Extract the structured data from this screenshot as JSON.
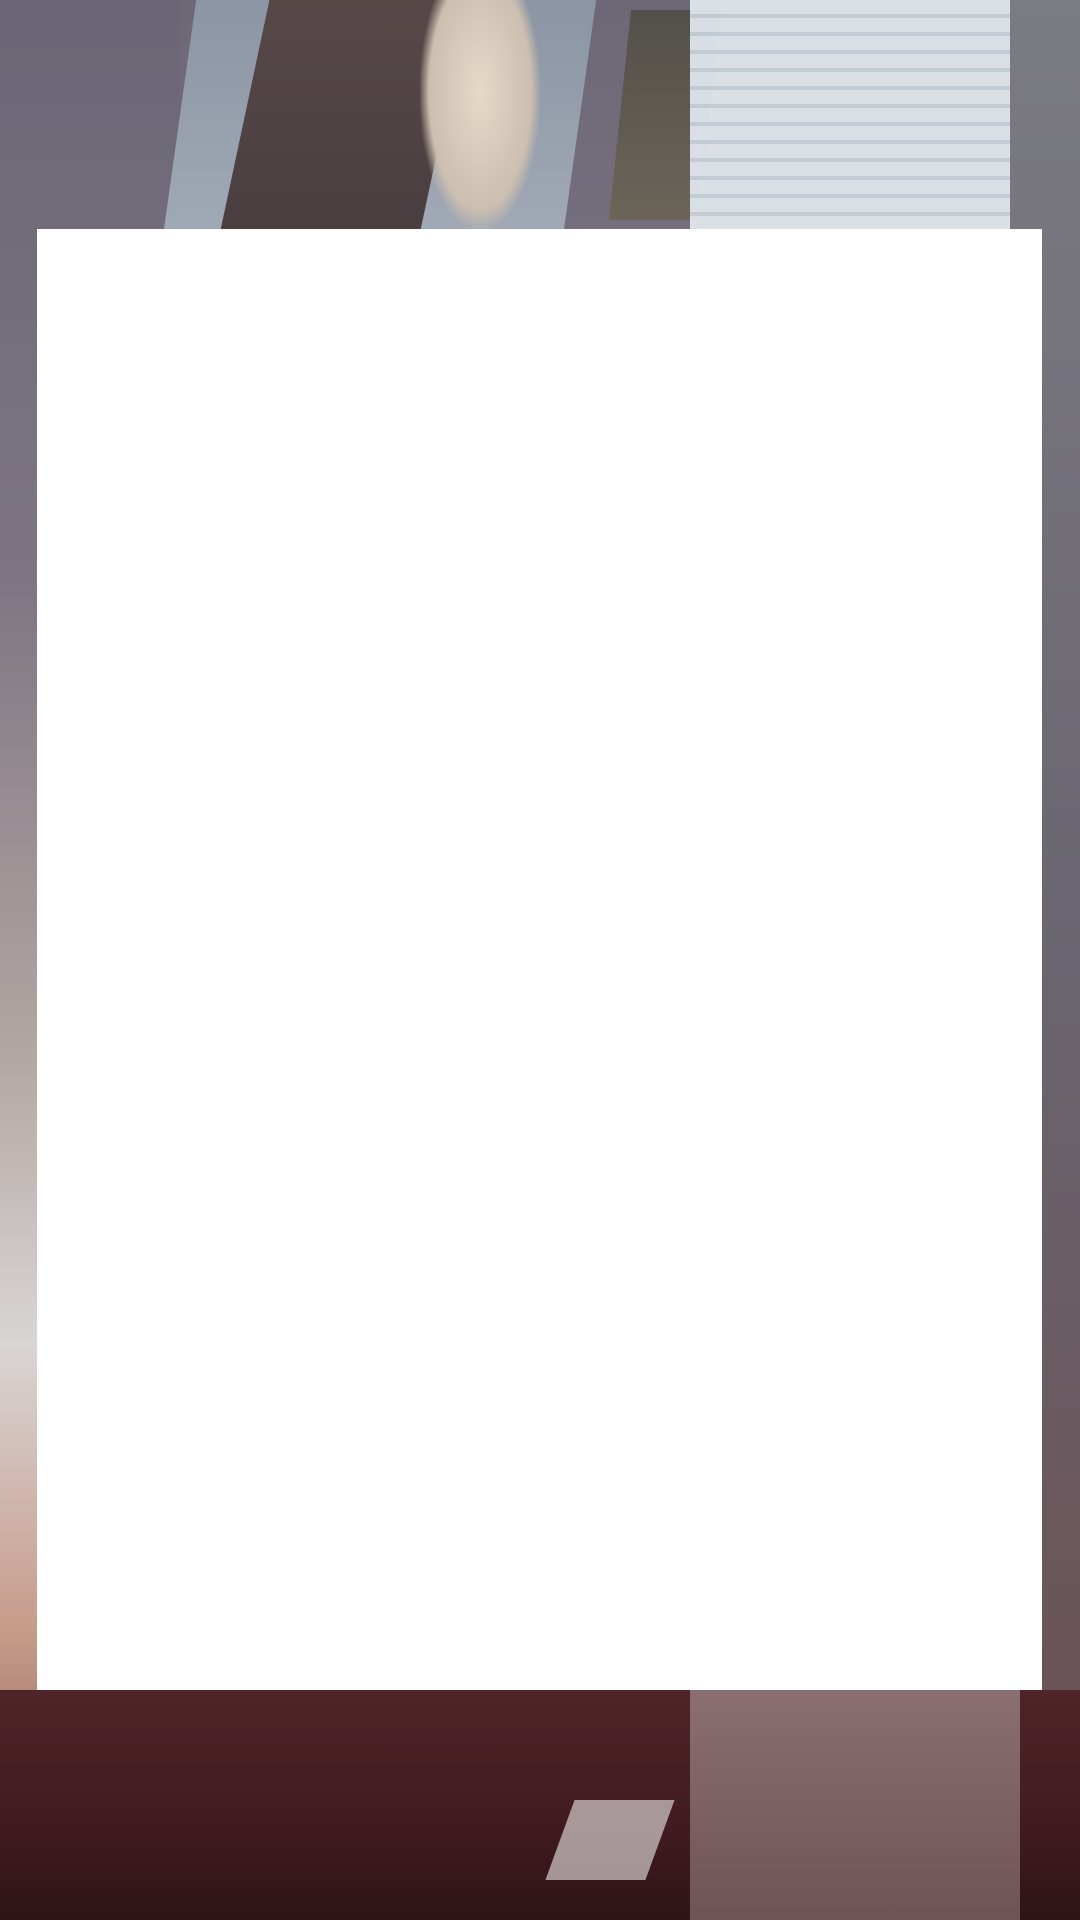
{
  "screen": {
    "type": "fullscreen-video-with-blank-overlay"
  },
  "background": {
    "description_icon": "photo-background",
    "scene": "camera-frame"
  },
  "overlay": {
    "color": "#ffffff"
  }
}
